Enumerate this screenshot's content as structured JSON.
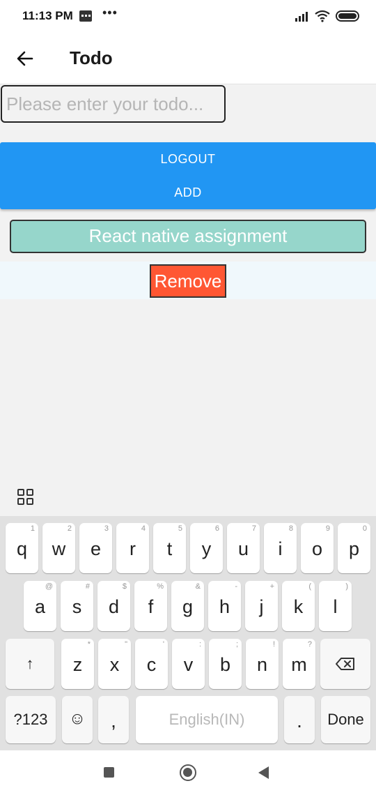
{
  "status_bar": {
    "time": "11:13 PM",
    "icons": [
      "message-icon",
      "more-dots-icon",
      "signal-icon",
      "wifi-icon",
      "battery-icon"
    ]
  },
  "header": {
    "title": "Todo",
    "back_icon": "arrow-left-icon"
  },
  "todo_form": {
    "input_placeholder": "Please enter your todo...",
    "input_value": "",
    "logout_label": "LOGOUT",
    "add_label": "ADD"
  },
  "todos": [
    {
      "text": "React native assignment",
      "remove_label": "Remove"
    }
  ],
  "keyboard": {
    "toolbar_icon": "grid-icon",
    "row1": [
      {
        "key": "q",
        "hint": "1"
      },
      {
        "key": "w",
        "hint": "2"
      },
      {
        "key": "e",
        "hint": "3"
      },
      {
        "key": "r",
        "hint": "4"
      },
      {
        "key": "t",
        "hint": "5"
      },
      {
        "key": "y",
        "hint": "6"
      },
      {
        "key": "u",
        "hint": "7"
      },
      {
        "key": "i",
        "hint": "8"
      },
      {
        "key": "o",
        "hint": "9"
      },
      {
        "key": "p",
        "hint": "0"
      }
    ],
    "row2": [
      {
        "key": "a",
        "hint": "@"
      },
      {
        "key": "s",
        "hint": "#"
      },
      {
        "key": "d",
        "hint": "$"
      },
      {
        "key": "f",
        "hint": "%"
      },
      {
        "key": "g",
        "hint": "&"
      },
      {
        "key": "h",
        "hint": "-"
      },
      {
        "key": "j",
        "hint": "+"
      },
      {
        "key": "k",
        "hint": "("
      },
      {
        "key": "l",
        "hint": ")"
      }
    ],
    "row3": [
      {
        "key": "z",
        "hint": "*"
      },
      {
        "key": "x",
        "hint": "\""
      },
      {
        "key": "c",
        "hint": "'"
      },
      {
        "key": "v",
        "hint": ":"
      },
      {
        "key": "b",
        "hint": ";"
      },
      {
        "key": "n",
        "hint": "!"
      },
      {
        "key": "m",
        "hint": "?"
      }
    ],
    "shift_symbol": "↑",
    "numbers_label": "?123",
    "emoji_symbol": "☺",
    "comma_label": ",",
    "space_label": "English(IN)",
    "period_label": ".",
    "done_label": "Done"
  },
  "nav_bar": {
    "icons": [
      "recents-square-icon",
      "home-circle-icon",
      "back-triangle-icon"
    ]
  }
}
